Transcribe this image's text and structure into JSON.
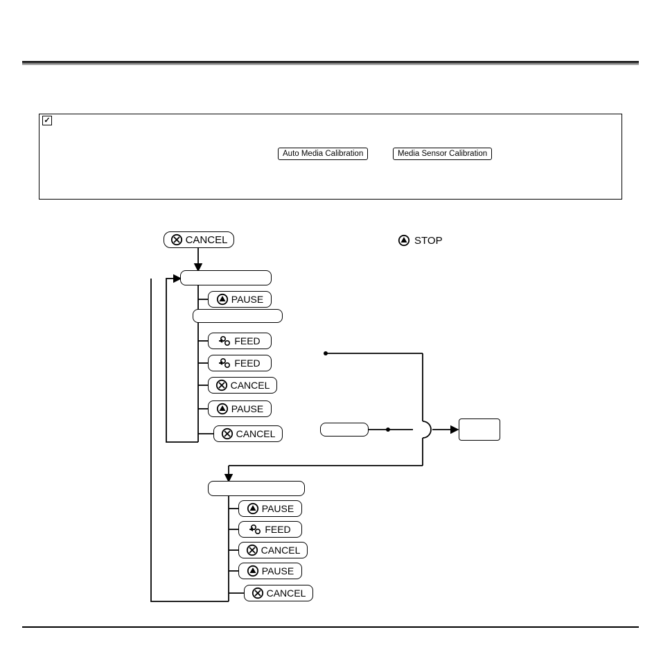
{
  "note_box": {
    "btn1": "Auto Media Calibration",
    "btn2": "Media Sensor Calibration"
  },
  "labels": {
    "cancel": "CANCEL",
    "stop": "STOP",
    "pause": "PAUSE",
    "feed": "FEED"
  }
}
